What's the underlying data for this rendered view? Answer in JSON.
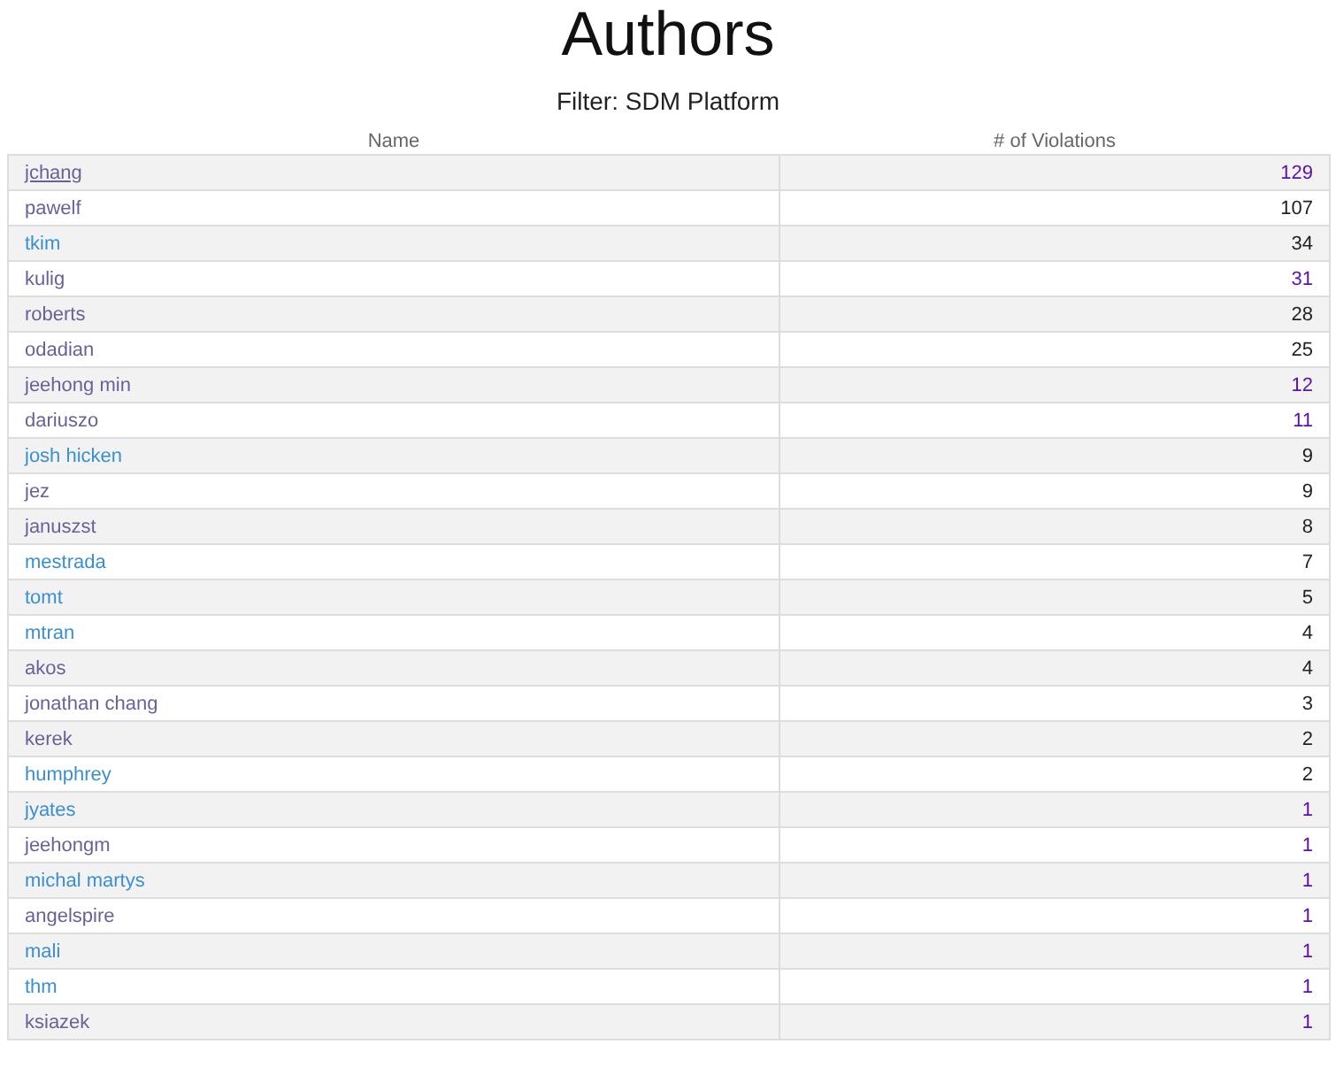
{
  "title": "Authors",
  "filter": "Filter: SDM Platform",
  "table": {
    "columns": [
      "Name",
      "# of Violations"
    ],
    "rows": [
      {
        "name": "jchang",
        "count": "129",
        "name_visited": true,
        "hovered": true,
        "count_visited": true
      },
      {
        "name": "pawelf",
        "count": "107",
        "name_visited": true,
        "hovered": false,
        "count_visited": false
      },
      {
        "name": "tkim",
        "count": "34",
        "name_visited": false,
        "hovered": false,
        "count_visited": false
      },
      {
        "name": "kulig",
        "count": "31",
        "name_visited": true,
        "hovered": false,
        "count_visited": true
      },
      {
        "name": "roberts",
        "count": "28",
        "name_visited": true,
        "hovered": false,
        "count_visited": false
      },
      {
        "name": "odadian",
        "count": "25",
        "name_visited": true,
        "hovered": false,
        "count_visited": false
      },
      {
        "name": "jeehong min",
        "count": "12",
        "name_visited": true,
        "hovered": false,
        "count_visited": true
      },
      {
        "name": "dariuszo",
        "count": "11",
        "name_visited": true,
        "hovered": false,
        "count_visited": true
      },
      {
        "name": "josh hicken",
        "count": "9",
        "name_visited": false,
        "hovered": false,
        "count_visited": false
      },
      {
        "name": "jez",
        "count": "9",
        "name_visited": true,
        "hovered": false,
        "count_visited": false
      },
      {
        "name": "januszst",
        "count": "8",
        "name_visited": true,
        "hovered": false,
        "count_visited": false
      },
      {
        "name": "mestrada",
        "count": "7",
        "name_visited": false,
        "hovered": false,
        "count_visited": false
      },
      {
        "name": "tomt",
        "count": "5",
        "name_visited": false,
        "hovered": false,
        "count_visited": false
      },
      {
        "name": "mtran",
        "count": "4",
        "name_visited": false,
        "hovered": false,
        "count_visited": false
      },
      {
        "name": "akos",
        "count": "4",
        "name_visited": true,
        "hovered": false,
        "count_visited": false
      },
      {
        "name": "jonathan chang",
        "count": "3",
        "name_visited": true,
        "hovered": false,
        "count_visited": false
      },
      {
        "name": "kerek",
        "count": "2",
        "name_visited": true,
        "hovered": false,
        "count_visited": false
      },
      {
        "name": "humphrey",
        "count": "2",
        "name_visited": false,
        "hovered": false,
        "count_visited": false
      },
      {
        "name": "jyates",
        "count": "1",
        "name_visited": false,
        "hovered": false,
        "count_visited": true
      },
      {
        "name": "jeehongm",
        "count": "1",
        "name_visited": true,
        "hovered": false,
        "count_visited": true
      },
      {
        "name": "michal martys",
        "count": "1",
        "name_visited": false,
        "hovered": false,
        "count_visited": true
      },
      {
        "name": "angelspire",
        "count": "1",
        "name_visited": true,
        "hovered": false,
        "count_visited": true
      },
      {
        "name": "mali",
        "count": "1",
        "name_visited": false,
        "hovered": false,
        "count_visited": true
      },
      {
        "name": "thm",
        "count": "1",
        "name_visited": false,
        "hovered": false,
        "count_visited": true
      },
      {
        "name": "ksiazek",
        "count": "1",
        "name_visited": true,
        "hovered": false,
        "count_visited": true
      }
    ]
  }
}
